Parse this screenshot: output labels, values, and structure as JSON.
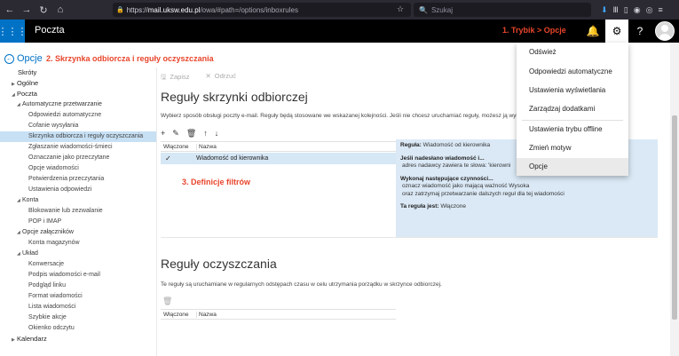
{
  "browser": {
    "url_domain": "mail.uksw.edu.pl",
    "url_path": "/owa/#path=/options/inboxrules",
    "url_prefix": "https://",
    "search_placeholder": "Szukaj"
  },
  "header": {
    "app_title": "Poczta",
    "annotation": "1. Trybik > Opcje"
  },
  "left": {
    "back_label": "Opcje",
    "annotation": "2. Skrzynka odbiorcza i reguły oczyszczania",
    "items": [
      {
        "label": "Skróty"
      },
      {
        "label": "Ogólne"
      },
      {
        "label": "Poczta"
      },
      {
        "label": "Automatyczne przetwarzanie"
      },
      {
        "label": "Odpowiedzi automatyczne"
      },
      {
        "label": "Cofanie wysyłania"
      },
      {
        "label": "Skrzynka odbiorcza i reguły oczyszczania"
      },
      {
        "label": "Zgłaszanie wiadomości-śmieci"
      },
      {
        "label": "Oznaczanie jako przeczytane"
      },
      {
        "label": "Opcje wiadomości"
      },
      {
        "label": "Potwierdzenia przeczytania"
      },
      {
        "label": "Ustawienia odpowiedzi"
      },
      {
        "label": "Konta"
      },
      {
        "label": "Blokowanie lub zezwalanie"
      },
      {
        "label": "POP i IMAP"
      },
      {
        "label": "Opcje załączników"
      },
      {
        "label": "Konta magazynów"
      },
      {
        "label": "Układ"
      },
      {
        "label": "Konwersacje"
      },
      {
        "label": "Podpis wiadomości e-mail"
      },
      {
        "label": "Podgląd linku"
      },
      {
        "label": "Format wiadomości"
      },
      {
        "label": "Lista wiadomości"
      },
      {
        "label": "Szybkie akcje"
      },
      {
        "label": "Okienko odczytu"
      },
      {
        "label": "Kalendarz"
      }
    ]
  },
  "toolbar": {
    "save": "Zapisz",
    "discard": "Odrzuć"
  },
  "inbox_rules": {
    "title": "Reguły skrzynki odbiorczej",
    "description": "Wybierz sposób obsługi poczty e-mail. Reguły będą stosowane we wskazanej kolejności. Jeśli nie chcesz uruchamiać reguły, możesz ją wyłączyć",
    "col_enabled": "Włączone",
    "col_name": "Nazwa",
    "rule_name": "Wiadomość od kierownika",
    "annotation": "3. Definicje filtrów",
    "details": {
      "rule_label": "Reguła:",
      "rule_value": "Wiadomość od kierownika",
      "cond_title": "Jeśli nadesłano wiadomość i...",
      "cond_text": "adres nadawcy zawiera te słowa: 'kierowni",
      "action_title": "Wykonaj następujące czynności...",
      "action_1": "oznacz wiadomość jako mającą ważność Wysoka",
      "action_2": "oraz zatrzymaj przetwarzanie dalszych reguł dla tej wiadomości",
      "status_label": "Ta reguła jest:",
      "status_value": "Włączone"
    }
  },
  "sweep_rules": {
    "title": "Reguły oczyszczania",
    "description": "Te reguły są uruchamiane w regularnych odstępach czasu w celu utrzymania porządku w skrzynce odbiorczej.",
    "col_enabled": "Włączone",
    "col_name": "Nazwa"
  },
  "dropdown": {
    "items": [
      {
        "label": "Odśwież"
      },
      {
        "label": "Odpowiedzi automatyczne"
      },
      {
        "label": "Ustawienia wyświetlania"
      },
      {
        "label": "Zarządzaj dodatkami"
      },
      {
        "label": "Ustawienia trybu offline"
      },
      {
        "label": "Zmień motyw"
      },
      {
        "label": "Opcje"
      }
    ]
  },
  "colors": {
    "accent": "#0072c6",
    "annotation": "#e8452b",
    "selection": "#c7e0f4"
  }
}
